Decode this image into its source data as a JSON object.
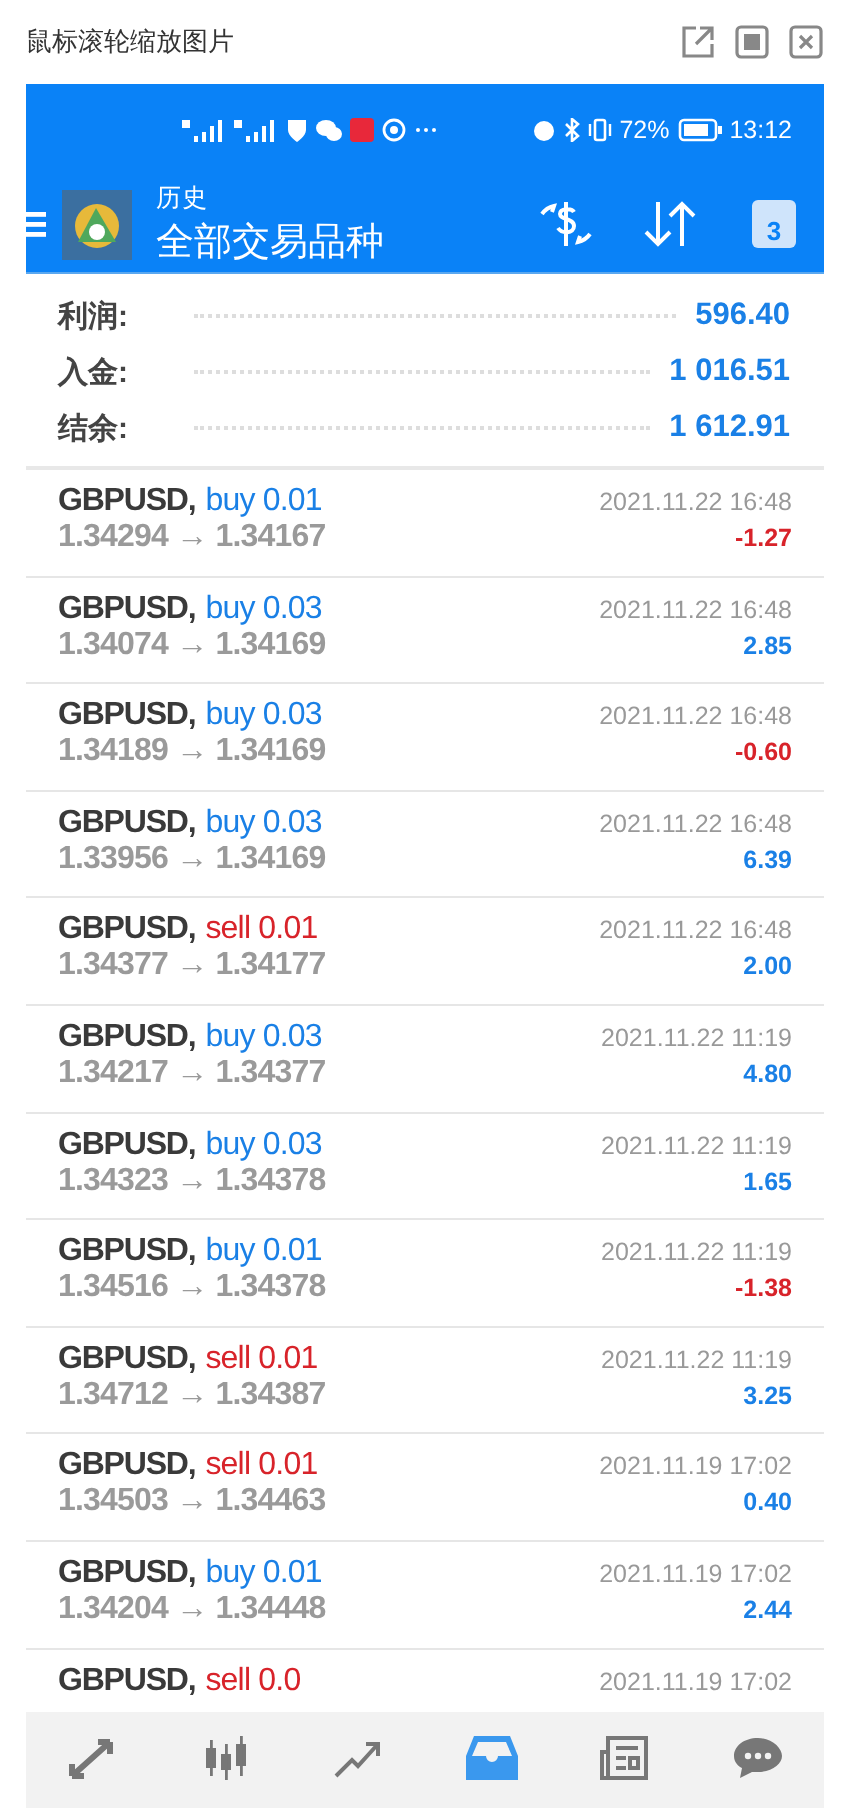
{
  "window": {
    "title": "鼠标滚轮缩放图片"
  },
  "status_bar": {
    "battery": "72%",
    "time": "13:12"
  },
  "toolbar": {
    "subtitle": "历史",
    "title": "全部交易品种",
    "calendar_day": "3"
  },
  "summary": [
    {
      "label": "利润:",
      "value": "596.40"
    },
    {
      "label": "入金:",
      "value": "1 016.51"
    },
    {
      "label": "结余:",
      "value": "1 612.91"
    }
  ],
  "trades": [
    {
      "symbol": "GBPUSD,",
      "kind": "buy",
      "side": "buy 0.01",
      "prices": "1.34294 → 1.34167",
      "time": "2021.11.22 16:48",
      "profit": "-1.27",
      "loss": true
    },
    {
      "symbol": "GBPUSD,",
      "kind": "buy",
      "side": "buy 0.03",
      "prices": "1.34074 → 1.34169",
      "time": "2021.11.22 16:48",
      "profit": "2.85",
      "loss": false
    },
    {
      "symbol": "GBPUSD,",
      "kind": "buy",
      "side": "buy 0.03",
      "prices": "1.34189 → 1.34169",
      "time": "2021.11.22 16:48",
      "profit": "-0.60",
      "loss": true
    },
    {
      "symbol": "GBPUSD,",
      "kind": "buy",
      "side": "buy 0.03",
      "prices": "1.33956 → 1.34169",
      "time": "2021.11.22 16:48",
      "profit": "6.39",
      "loss": false
    },
    {
      "symbol": "GBPUSD,",
      "kind": "sell",
      "side": "sell 0.01",
      "prices": "1.34377 → 1.34177",
      "time": "2021.11.22 16:48",
      "profit": "2.00",
      "loss": false
    },
    {
      "symbol": "GBPUSD,",
      "kind": "buy",
      "side": "buy 0.03",
      "prices": "1.34217 → 1.34377",
      "time": "2021.11.22 11:19",
      "profit": "4.80",
      "loss": false
    },
    {
      "symbol": "GBPUSD,",
      "kind": "buy",
      "side": "buy 0.03",
      "prices": "1.34323 → 1.34378",
      "time": "2021.11.22 11:19",
      "profit": "1.65",
      "loss": false
    },
    {
      "symbol": "GBPUSD,",
      "kind": "buy",
      "side": "buy 0.01",
      "prices": "1.34516 → 1.34378",
      "time": "2021.11.22 11:19",
      "profit": "-1.38",
      "loss": true
    },
    {
      "symbol": "GBPUSD,",
      "kind": "sell",
      "side": "sell 0.01",
      "prices": "1.34712 → 1.34387",
      "time": "2021.11.22 11:19",
      "profit": "3.25",
      "loss": false
    },
    {
      "symbol": "GBPUSD,",
      "kind": "sell",
      "side": "sell 0.01",
      "prices": "1.34503 → 1.34463",
      "time": "2021.11.19 17:02",
      "profit": "0.40",
      "loss": false
    },
    {
      "symbol": "GBPUSD,",
      "kind": "buy",
      "side": "buy 0.01",
      "prices": "1.34204 → 1.34448",
      "time": "2021.11.19 17:02",
      "profit": "2.44",
      "loss": false
    },
    {
      "symbol": "GBPUSD,",
      "kind": "sell",
      "side": "sell 0.0",
      "time": "2021.11.19 17:02"
    }
  ],
  "bottom_nav": [
    {
      "kind": "quotes",
      "selected": false
    },
    {
      "kind": "chart",
      "selected": false
    },
    {
      "kind": "trade",
      "selected": false
    },
    {
      "kind": "history",
      "selected": true
    },
    {
      "kind": "news",
      "selected": false
    },
    {
      "kind": "chat",
      "selected": false
    }
  ]
}
